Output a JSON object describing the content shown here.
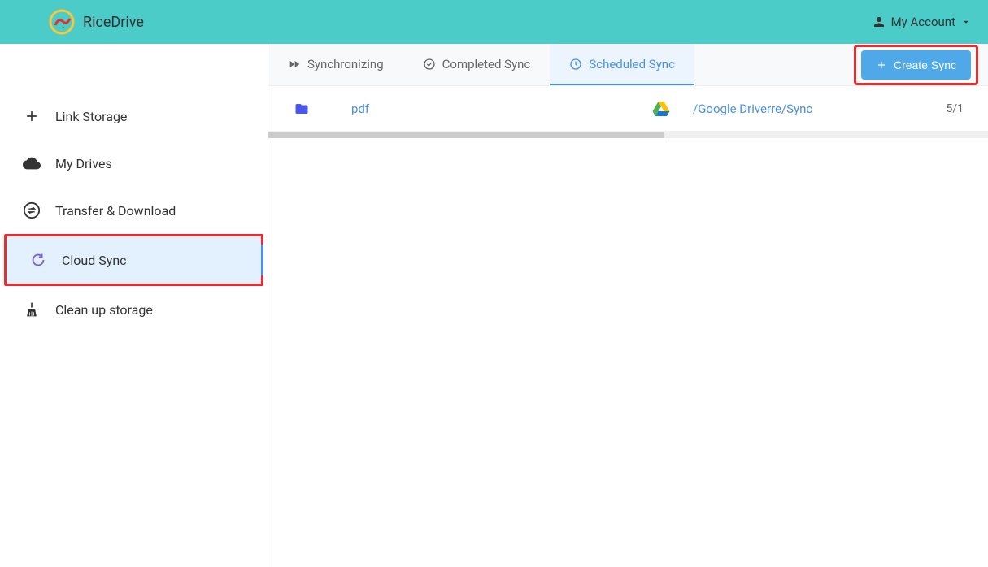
{
  "header": {
    "brand": "RiceDrive",
    "account_label": "My Account"
  },
  "sidebar": {
    "items": [
      {
        "label": "Link Storage",
        "icon": "plus"
      },
      {
        "label": "My Drives",
        "icon": "cloud"
      },
      {
        "label": "Transfer & Download",
        "icon": "swap"
      },
      {
        "label": "Cloud Sync",
        "icon": "sync",
        "active": true,
        "highlighted": true
      },
      {
        "label": "Clean up storage",
        "icon": "broom"
      }
    ]
  },
  "tabs": [
    {
      "label": "Synchronizing",
      "icon": "fast-forward"
    },
    {
      "label": "Completed Sync",
      "icon": "check-circle"
    },
    {
      "label": "Scheduled Sync",
      "icon": "clock",
      "active": true
    }
  ],
  "create_button": {
    "label": "Create Sync",
    "highlighted": true
  },
  "sync_rows": [
    {
      "source_name": "pdf",
      "source_icon": "folder",
      "dest_icon": "google-drive",
      "dest_path": "/Google Driverre/Sync",
      "date_fragment": "5/1"
    }
  ]
}
